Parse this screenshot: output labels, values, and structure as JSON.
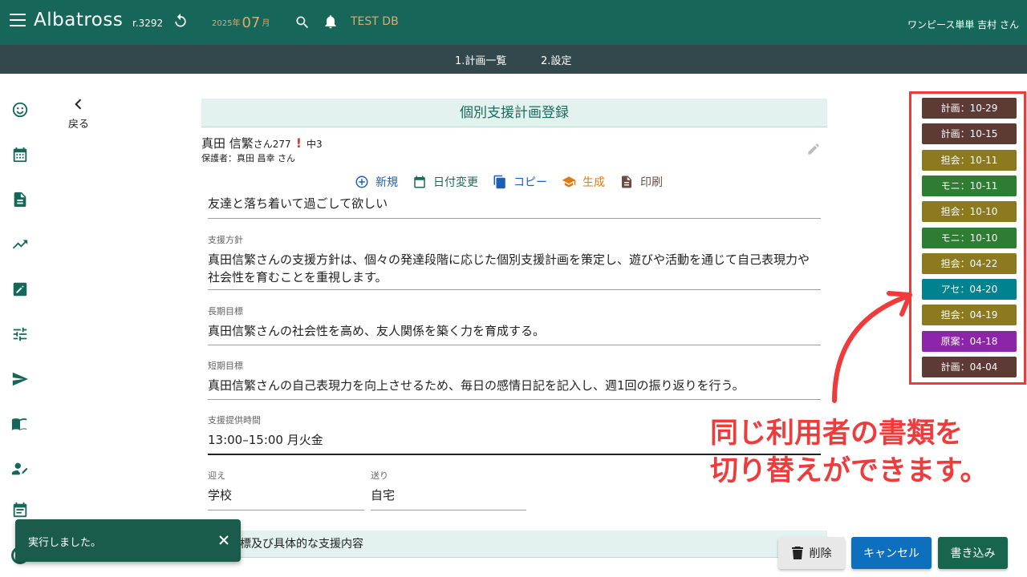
{
  "header": {
    "app_name": "Albatross",
    "revision": "r.3292",
    "year": "2025年",
    "month": "07",
    "month_suffix": "月",
    "db": "TEST DB",
    "user": "ワンピース単単 吉村 さん",
    "bg": "#16665a"
  },
  "subnav": {
    "tabs": [
      "1.計画一覧",
      "2.設定"
    ]
  },
  "sidebar": {
    "icons": [
      "smiley-icon",
      "calendar-icon",
      "document-icon",
      "trending-icon",
      "edit-square-icon",
      "tune-icon",
      "send-icon",
      "book-icon",
      "person-edit-icon",
      "event-note-icon"
    ]
  },
  "back": {
    "label": "戻る"
  },
  "form": {
    "title": "個別支援計画登録",
    "client_name": "真田 信繁",
    "client_san": "さん277",
    "client_alert": "!",
    "client_grade": "中3",
    "guardian": "保護者：真田 昌幸 さん",
    "actions": {
      "new": "新規",
      "date_change": "日付変更",
      "copy": "コピー",
      "generate": "生成",
      "print": "印刷"
    },
    "fields": {
      "wish": {
        "value": "友達と落ち着いて過ごして欲しい"
      },
      "policy": {
        "label": "支援方針",
        "value": "真田信繁さんの支援方針は、個々の発達段階に応じた個別支援計画を策定し、遊びや活動を通じて自己表現力や社会性を育むことを重視します。"
      },
      "long_goal": {
        "label": "長期目標",
        "value": "真田信繁さんの社会性を高め、友人関係を築く力を育成する。"
      },
      "short_goal": {
        "label": "短期目標",
        "value": "真田信繁さんの自己表現力を向上させるため、毎日の感情日記を記入し、週1回の振り返りを行う。"
      },
      "time": {
        "label": "支援提供時間",
        "value": "13:00–15:00 月火金"
      },
      "pickup": {
        "label": "迎え",
        "value": "学校"
      },
      "dropoff": {
        "label": "送り",
        "value": "自宅"
      }
    },
    "section2_title": "標及び具体的な支援内容"
  },
  "toast": {
    "message": "実行しました。"
  },
  "buttons": {
    "delete": "削除",
    "cancel": "キャンセル",
    "save": "書き込み"
  },
  "history": [
    {
      "label": "計画：10-29",
      "color": "#5d3a33"
    },
    {
      "label": "計画：10-15",
      "color": "#5d3a33"
    },
    {
      "label": "担会：10-11",
      "color": "#8b7a1f"
    },
    {
      "label": "モニ：10-11",
      "color": "#2e7d32"
    },
    {
      "label": "担会：10-10",
      "color": "#8b7a1f"
    },
    {
      "label": "モニ：10-10",
      "color": "#2e7d32"
    },
    {
      "label": "担会：04-22",
      "color": "#8b7a1f"
    },
    {
      "label": "アセ：04-20",
      "color": "#00838f"
    },
    {
      "label": "担会：04-19",
      "color": "#8b7a1f"
    },
    {
      "label": "原案：04-18",
      "color": "#8e24aa"
    },
    {
      "label": "計画：04-04",
      "color": "#5d3a33"
    }
  ],
  "annotation": {
    "line1": "同じ利用者の書類を",
    "line2": "切り替えができます。",
    "color": "#ee3b3b"
  }
}
